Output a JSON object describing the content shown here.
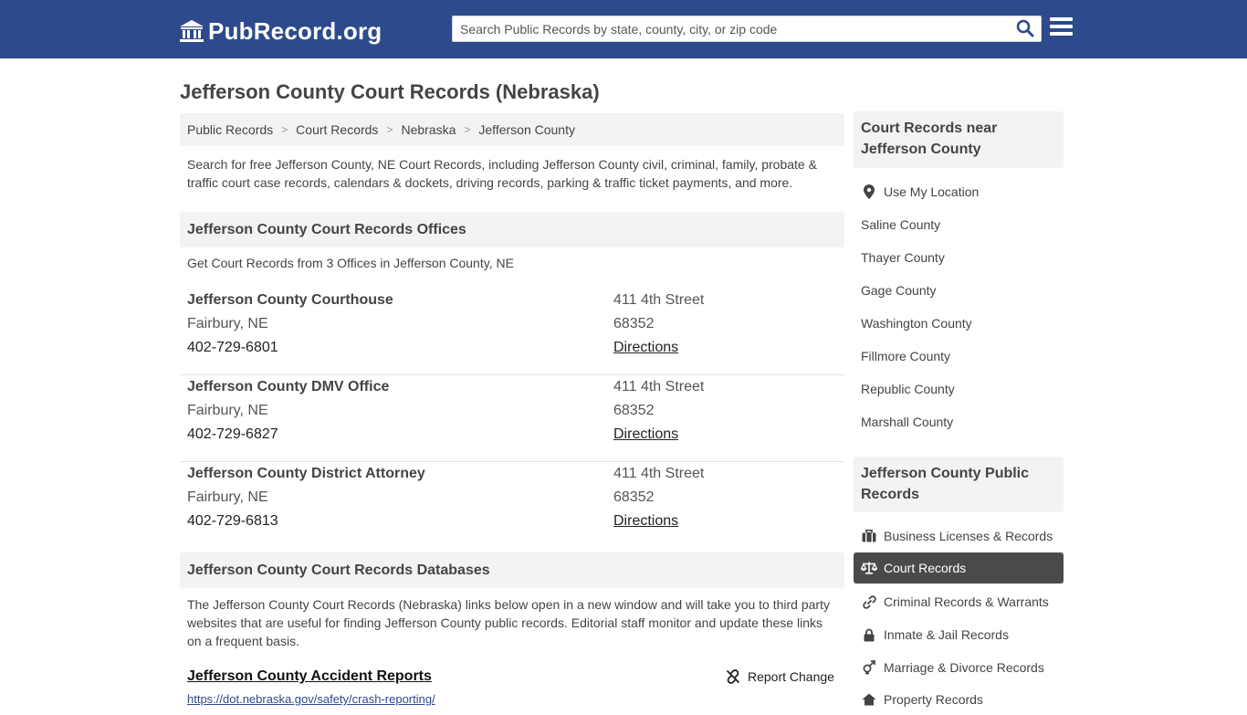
{
  "header": {
    "logo_text": "PubRecord.org",
    "search_placeholder": "Search Public Records by state, county, city, or zip code",
    "colors": {
      "brand": "#2d4a8c"
    }
  },
  "main": {
    "title": "Jefferson County Court Records (Nebraska)",
    "breadcrumb": [
      "Public Records",
      "Court Records",
      "Nebraska",
      "Jefferson County"
    ],
    "intro": "Search for free Jefferson County, NE Court Records, including Jefferson County civil, criminal, family, probate & traffic court case records, calendars & dockets, driving records, parking & traffic ticket payments, and more.",
    "offices_heading": "Jefferson County Court Records Offices",
    "offices_sub": "Get Court Records from 3 Offices in Jefferson County, NE",
    "offices": [
      {
        "name": "Jefferson County Courthouse",
        "city": "Fairbury, NE",
        "phone": "402-729-6801",
        "street": "411 4th Street",
        "zip": "68352",
        "directions": "Directions"
      },
      {
        "name": "Jefferson County DMV Office",
        "city": "Fairbury, NE",
        "phone": "402-729-6827",
        "street": "411 4th Street",
        "zip": "68352",
        "directions": "Directions"
      },
      {
        "name": "Jefferson County District Attorney",
        "city": "Fairbury, NE",
        "phone": "402-729-6813",
        "street": "411 4th Street",
        "zip": "68352",
        "directions": "Directions"
      }
    ],
    "databases_heading": "Jefferson County Court Records Databases",
    "databases_intro": "The Jefferson County Court Records (Nebraska) links below open in a new window and will take you to third party websites that are useful for finding Jefferson County public records. Editorial staff monitor and update these links on a frequent basis.",
    "database_link": {
      "title": "Jefferson County Accident Reports",
      "url": "https://dot.nebraska.gov/safety/crash-reporting/"
    },
    "report_change": "Report Change"
  },
  "sidebar": {
    "nearby_heading": "Court Records near Jefferson County",
    "use_location": "Use My Location",
    "nearby": [
      "Saline County",
      "Thayer County",
      "Gage County",
      "Washington County",
      "Fillmore County",
      "Republic County",
      "Marshall County"
    ],
    "public_heading": "Jefferson County Public Records",
    "public_items": [
      {
        "label": "Business Licenses & Records",
        "icon": "briefcase-icon"
      },
      {
        "label": "Court Records",
        "icon": "scales-icon",
        "active": true
      },
      {
        "label": "Criminal Records & Warrants",
        "icon": "link-icon"
      },
      {
        "label": "Inmate & Jail Records",
        "icon": "lock-icon"
      },
      {
        "label": "Marriage & Divorce Records",
        "icon": "gender-icon"
      },
      {
        "label": "Property Records",
        "icon": "home-icon"
      }
    ],
    "colors": {
      "active_bg": "#4a4a4a"
    }
  }
}
